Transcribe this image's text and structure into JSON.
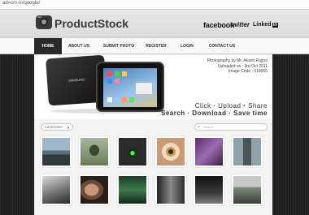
{
  "browser": {
    "url": "ad=cm-in/qoogle/"
  },
  "header": {
    "logo_text": "ProductStock",
    "social": {
      "facebook": "facebook",
      "twitter": "twitter",
      "linkedin": "Linked",
      "linkedin_badge": "in"
    }
  },
  "nav": {
    "items": [
      {
        "label": "HOME",
        "active": true
      },
      {
        "label": "ABOUT US",
        "active": false
      },
      {
        "label": "SUBMIT PHOTO",
        "active": false
      },
      {
        "label": "REGISTER",
        "active": false
      },
      {
        "label": "LOGIN",
        "active": false
      },
      {
        "label": "CONTACT US",
        "active": false
      }
    ]
  },
  "banner": {
    "credit": "Photography by Mr. Akash Rajput",
    "uploaded": "Uploaded on : 3rd Oct 2011",
    "image_code": "Image Code : 018065",
    "tablet_brand": "SAMSUNG",
    "tagline_top": [
      "Click",
      "Upload",
      "Share"
    ],
    "tagline_bottom": [
      "Search",
      "Download",
      "Save time"
    ]
  },
  "toolbar": {
    "category_label": "CATEGORY",
    "search_placeholder": "Search"
  },
  "colors": {
    "nav_active_bg": "#2a2a2a",
    "stage_bg": "#222222"
  },
  "thumbnails": [
    {
      "subject": "bridge-over-lake"
    },
    {
      "subject": "runner-at-start"
    },
    {
      "subject": "traffic-light-green"
    },
    {
      "subject": "eye-closeup"
    },
    {
      "subject": "purple-figures"
    },
    {
      "subject": "road-perspective"
    },
    {
      "subject": "tree-silhouette"
    },
    {
      "subject": "woman-portrait"
    },
    {
      "subject": "green-forest"
    },
    {
      "subject": "grey-figure"
    },
    {
      "subject": "street-night"
    },
    {
      "subject": "pier-walkway"
    }
  ]
}
